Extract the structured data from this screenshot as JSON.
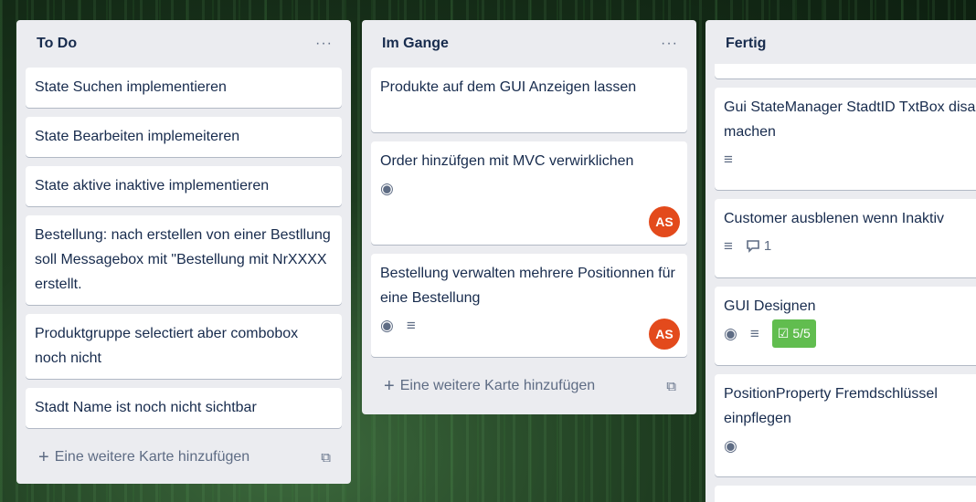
{
  "lists": [
    {
      "title": "To Do",
      "menu": "···",
      "cards": [
        {
          "text": "State Suchen implementieren"
        },
        {
          "text": "State Bearbeiten implemeiteren"
        },
        {
          "text": "State aktive inaktive implementieren"
        },
        {
          "text": "Bestellung: nach erstellen von einer Bestllung soll Messagebox mit \"Bestellung mit NrXXXX erstellt."
        },
        {
          "text": "Produktgruppe selectiert aber combobox noch nicht"
        },
        {
          "text": "Stadt Name ist noch nicht sichtbar"
        }
      ],
      "add_label": "Eine weitere Karte hinzufügen"
    },
    {
      "title": "Im Gange",
      "menu": "···",
      "cards": [
        {
          "text": "Produkte auf dem GUI Anzeigen lassen"
        },
        {
          "text": "Order hinzüfgen mit MVC verwirklichen",
          "avatar": "AS"
        },
        {
          "text": "Bestellung verwalten mehrere Positionnen für eine Bestellung",
          "avatar": "AS"
        }
      ],
      "add_label": "Eine weitere Karte hinzufügen"
    },
    {
      "title": "Fertig",
      "cards": [
        {
          "text": "Gui StateManager StadtID TxtBox disable machen"
        },
        {
          "text": "Customer ausblenen wenn Inaktiv",
          "comments": "1"
        },
        {
          "text": "GUI Designen",
          "checklist": "5/5"
        },
        {
          "text": "PositionProperty Fremdschlüssel einpflegen"
        }
      ]
    }
  ],
  "icons": {
    "plus": "+",
    "watch": "◉",
    "description": "≡",
    "comment": "💬",
    "checklist": "☑",
    "template": "⧉"
  },
  "colors": {
    "list_bg": "#ebecf0",
    "avatar": "#e34a1c",
    "checklist_complete": "#61bd4f"
  }
}
